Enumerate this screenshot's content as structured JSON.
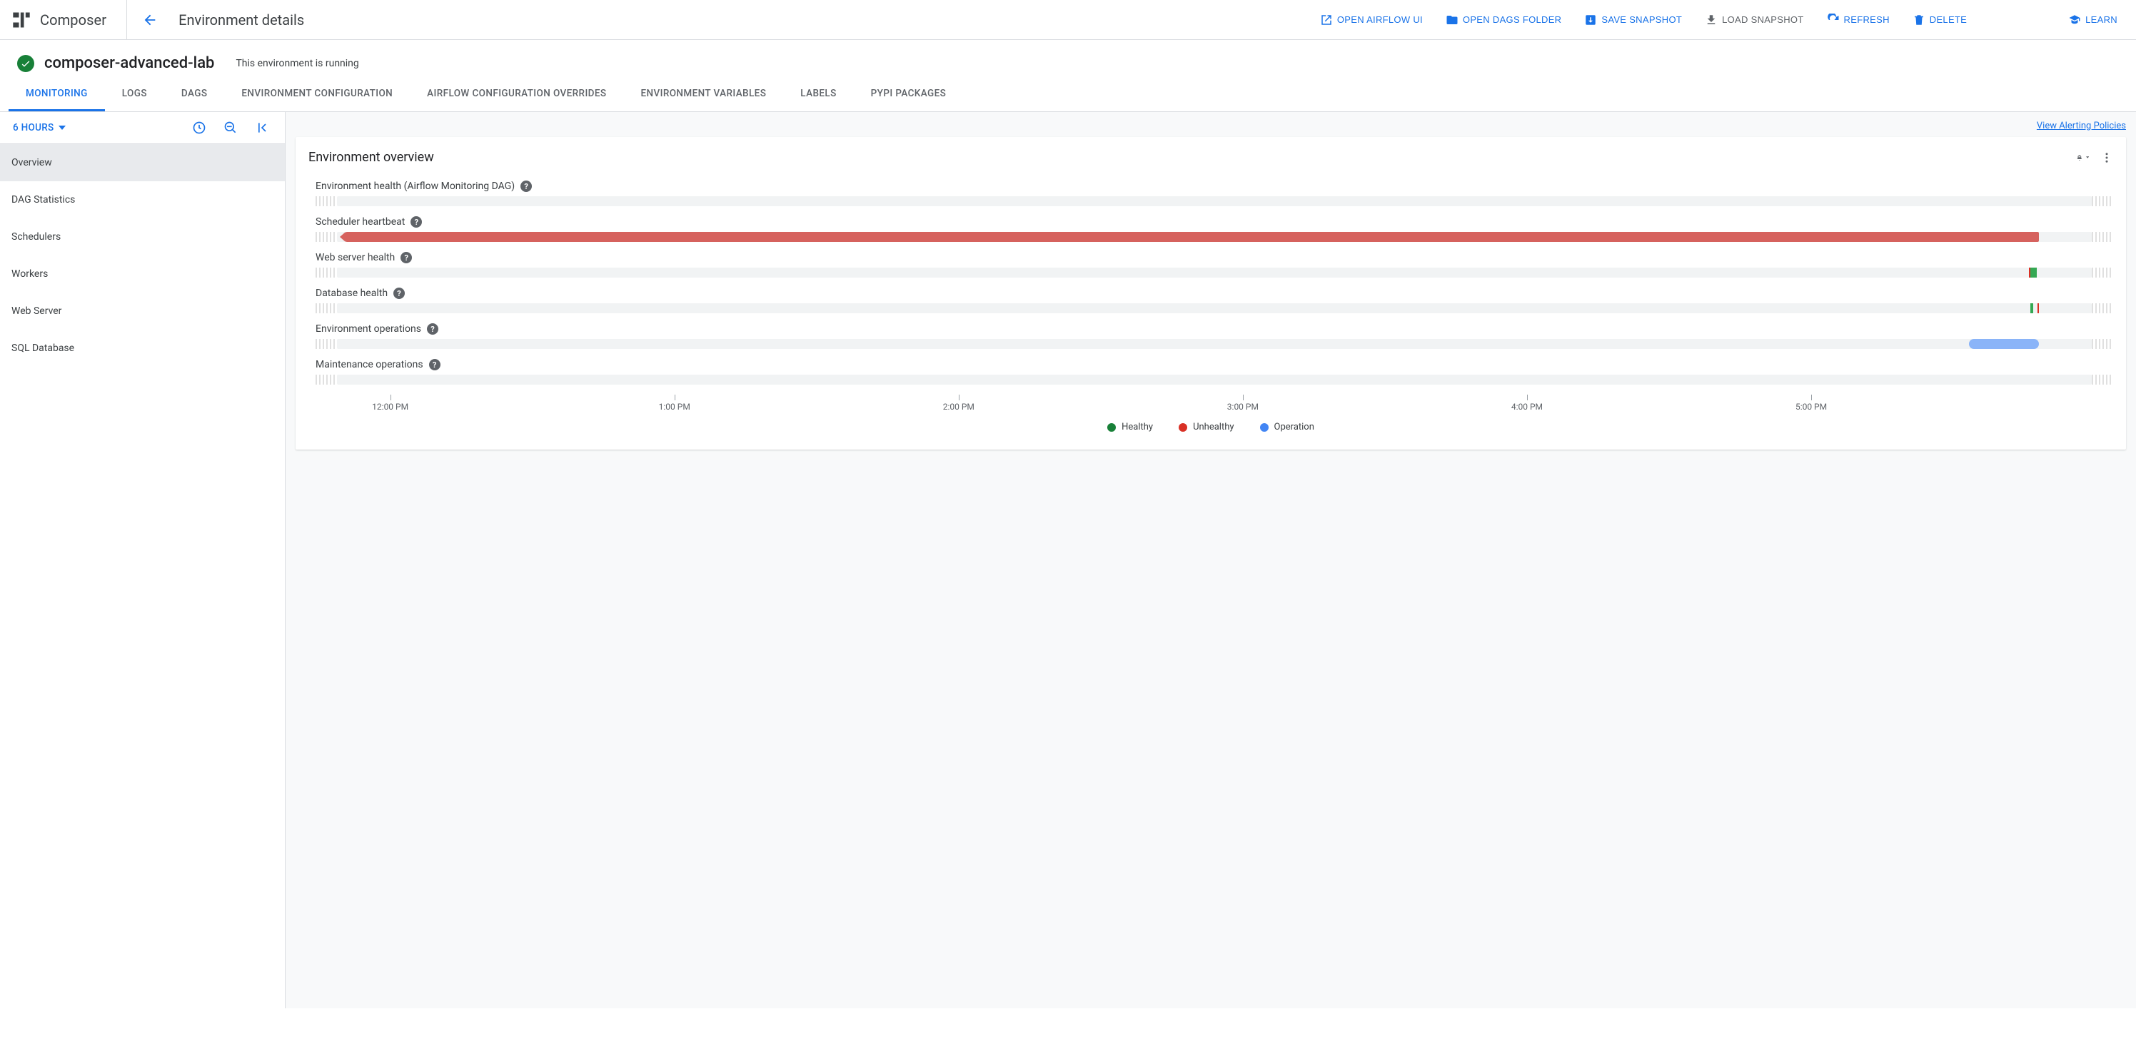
{
  "product": "Composer",
  "page_title": "Environment details",
  "actions": {
    "open_airflow": "OPEN AIRFLOW UI",
    "open_dags": "OPEN DAGS FOLDER",
    "save_snapshot": "SAVE SNAPSHOT",
    "load_snapshot": "LOAD SNAPSHOT",
    "refresh": "REFRESH",
    "delete": "DELETE",
    "learn": "LEARN"
  },
  "environment": {
    "name": "composer-advanced-lab",
    "status_text": "This environment is running"
  },
  "tabs": [
    "MONITORING",
    "LOGS",
    "DAGS",
    "ENVIRONMENT CONFIGURATION",
    "AIRFLOW CONFIGURATION OVERRIDES",
    "ENVIRONMENT VARIABLES",
    "LABELS",
    "PYPI PACKAGES"
  ],
  "active_tab": 0,
  "sidebar": {
    "time_range": "6 HOURS",
    "items": [
      "Overview",
      "DAG Statistics",
      "Schedulers",
      "Workers",
      "Web Server",
      "SQL Database"
    ],
    "active_item": 0
  },
  "alert_link": "View Alerting Policies",
  "card": {
    "title": "Environment overview",
    "metrics": [
      {
        "label": "Environment health (Airflow Monitoring DAG)"
      },
      {
        "label": "Scheduler heartbeat"
      },
      {
        "label": "Web server health"
      },
      {
        "label": "Database health"
      },
      {
        "label": "Environment operations"
      },
      {
        "label": "Maintenance operations"
      }
    ],
    "axis_labels": [
      "12:00 PM",
      "1:00 PM",
      "2:00 PM",
      "3:00 PM",
      "4:00 PM",
      "5:00 PM"
    ],
    "legend": {
      "healthy": "Healthy",
      "unhealthy": "Unhealthy",
      "operation": "Operation"
    }
  },
  "chart_data": {
    "type": "bar",
    "time_axis": [
      "12:00 PM",
      "1:00 PM",
      "2:00 PM",
      "3:00 PM",
      "4:00 PM",
      "5:00 PM"
    ],
    "series": [
      {
        "name": "Environment health (Airflow Monitoring DAG)",
        "segments": []
      },
      {
        "name": "Scheduler heartbeat",
        "segments": [
          {
            "state": "unhealthy",
            "start_pct": 0,
            "end_pct": 97
          }
        ]
      },
      {
        "name": "Web server health",
        "segments": [
          {
            "state": "healthy",
            "start_pct": 96.5,
            "end_pct": 97.2
          }
        ]
      },
      {
        "name": "Database health",
        "segments": [
          {
            "state": "healthy",
            "start_pct": 96.5,
            "end_pct": 97.0
          },
          {
            "state": "unhealthy",
            "start_pct": 96.8,
            "end_pct": 97.0
          }
        ]
      },
      {
        "name": "Environment operations",
        "segments": [
          {
            "state": "operation",
            "start_pct": 93,
            "end_pct": 97
          }
        ]
      },
      {
        "name": "Maintenance operations",
        "segments": []
      }
    ]
  }
}
